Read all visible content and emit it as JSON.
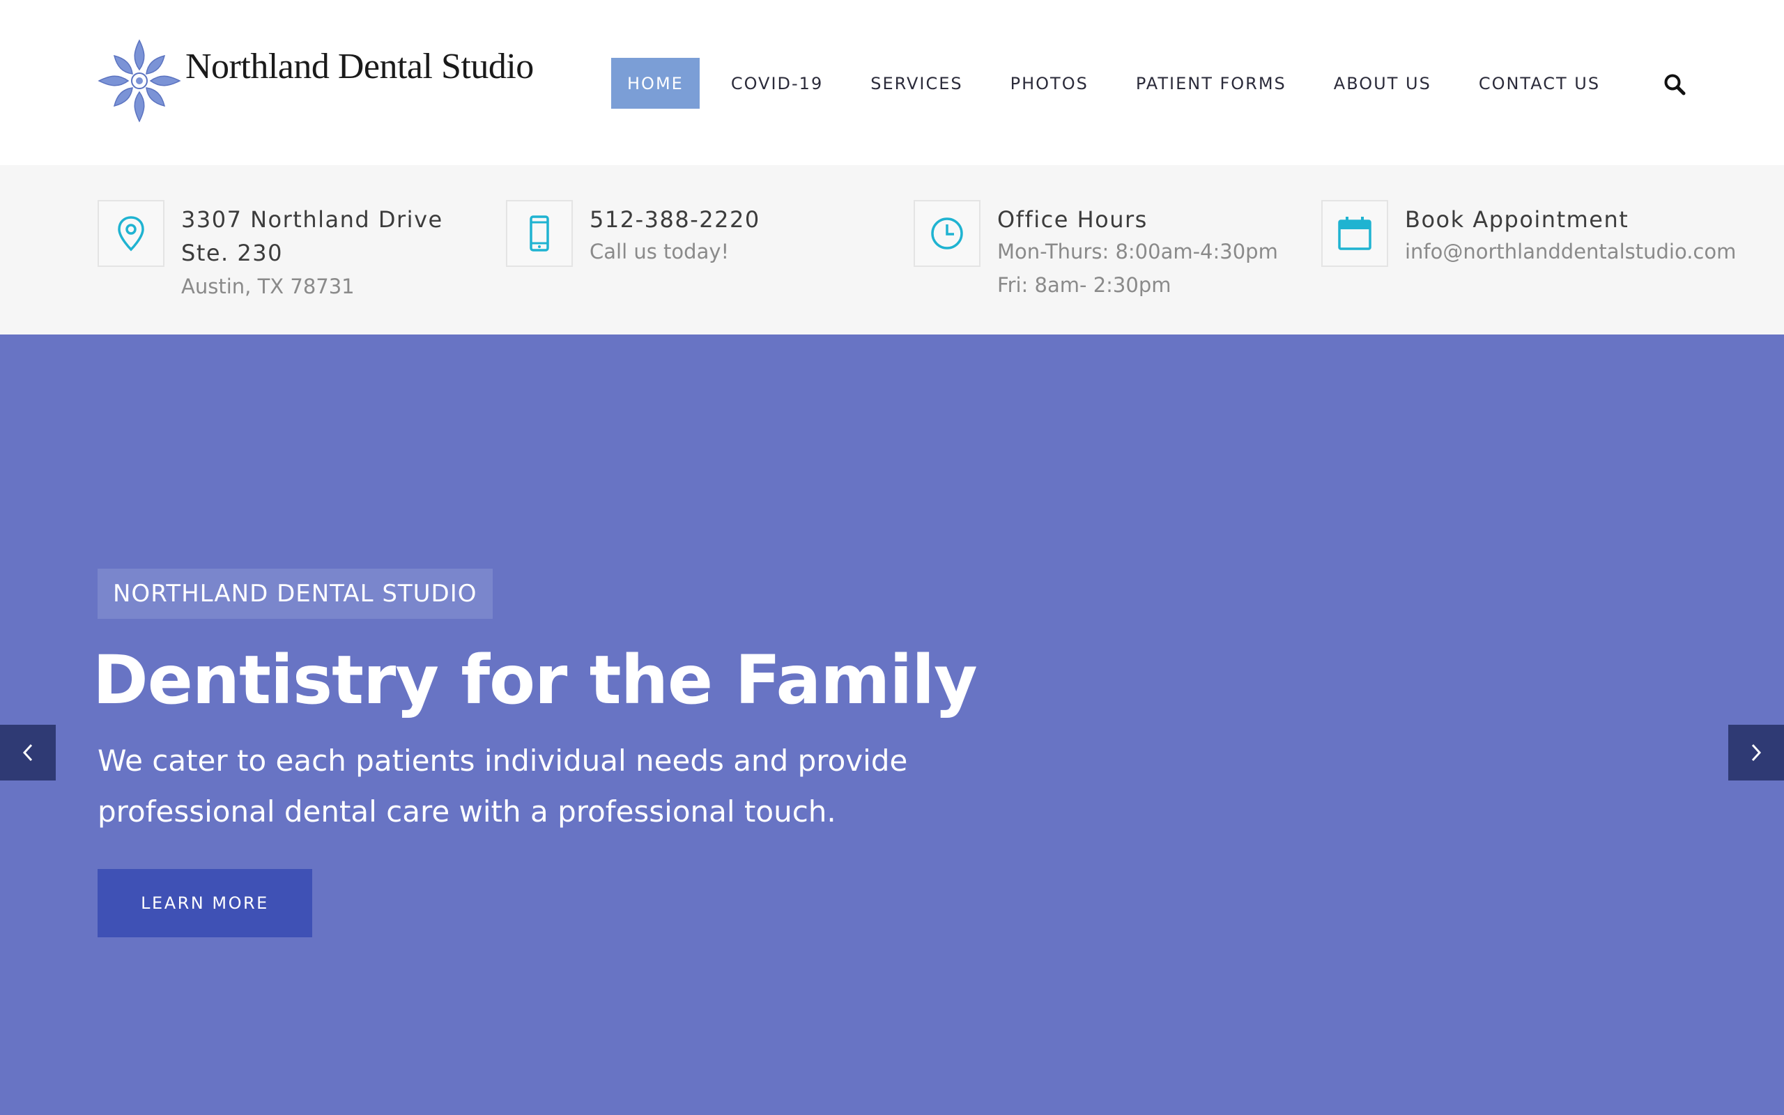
{
  "brand": {
    "name": "Northland Dental Studio",
    "logo_icon": "floral-medallion-icon",
    "logo_color": "#7b93d6"
  },
  "nav": {
    "items": [
      {
        "label": "HOME",
        "active": true
      },
      {
        "label": "COVID-19",
        "active": false
      },
      {
        "label": "SERVICES",
        "active": false
      },
      {
        "label": "PHOTOS",
        "active": false
      },
      {
        "label": "PATIENT FORMS",
        "active": false
      },
      {
        "label": "ABOUT US",
        "active": false
      },
      {
        "label": "CONTACT US",
        "active": false
      }
    ],
    "active_color": "#7b9ed6",
    "search_icon": "search-icon"
  },
  "info": {
    "accent_color": "#1fb3d1",
    "address": {
      "icon": "map-pin-icon",
      "line1": "3307 Northland Drive",
      "line2": "Ste. 230",
      "line3": "Austin, TX 78731"
    },
    "phone": {
      "icon": "mobile-phone-icon",
      "number": "512-388-2220",
      "note": "Call us today!"
    },
    "hours": {
      "icon": "clock-icon",
      "title": "Office Hours",
      "line1": "Mon-Thurs: 8:00am-4:30pm",
      "line2": "Fri: 8am- 2:30pm"
    },
    "booking": {
      "icon": "calendar-icon",
      "title": "Book Appointment",
      "email": "info@northlanddentalstudio.com"
    }
  },
  "hero": {
    "background_color": "#6874c4",
    "badge": "NORTHLAND DENTAL STUDIO",
    "title": "Dentistry for the Family",
    "text_line1": "We cater to each patients individual needs and provide",
    "text_line2": "professional dental care with a professional touch.",
    "button_label": "LEARN MORE",
    "button_color": "#3f51b5",
    "prev_icon": "chevron-left-icon",
    "next_icon": "chevron-right-icon"
  }
}
